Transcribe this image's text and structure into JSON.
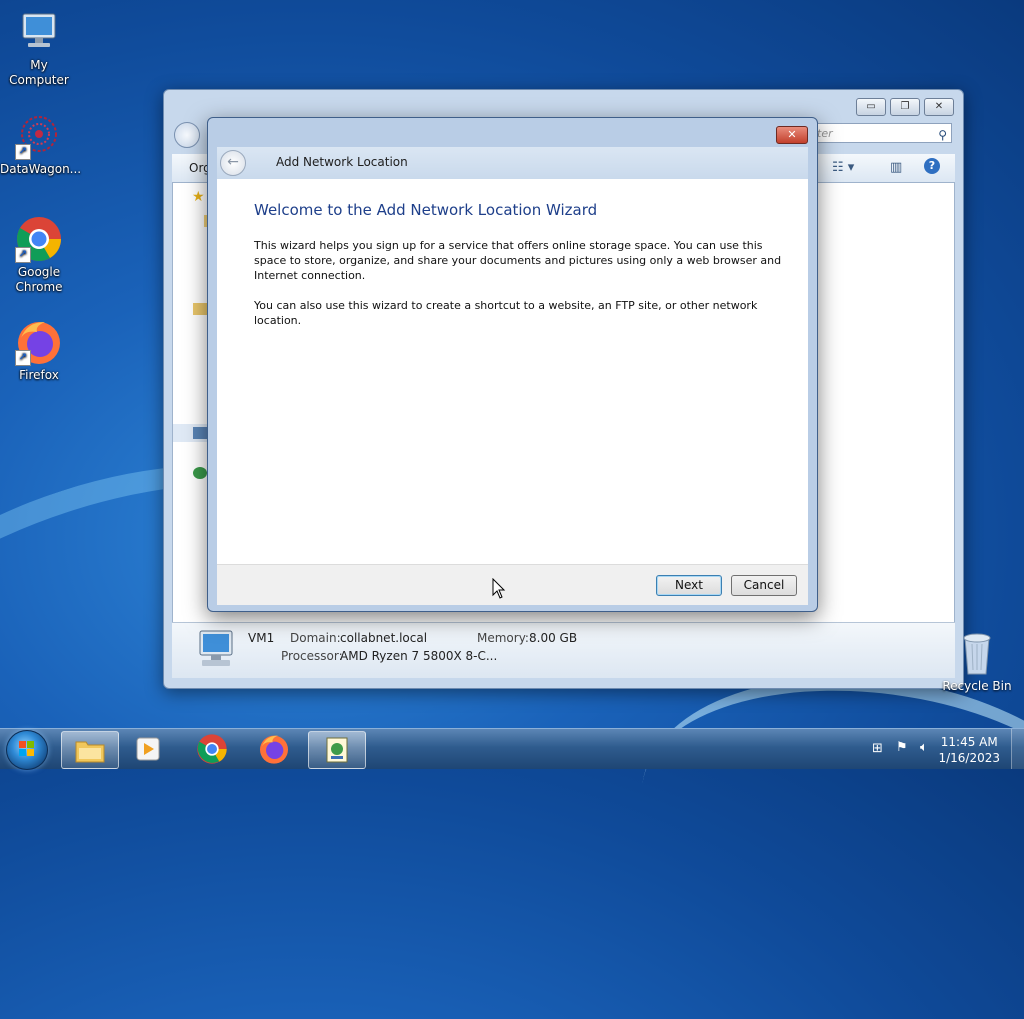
{
  "desktop": {
    "icons": [
      {
        "label": "My Computer"
      },
      {
        "label": "DataWagon..."
      },
      {
        "label": "Google Chrome"
      },
      {
        "label": "Firefox"
      }
    ],
    "recycle_bin": "Recycle Bin"
  },
  "explorer": {
    "search_placeholder": "ter",
    "organize_label": "Org",
    "details": {
      "computer_name": "VM1",
      "domain_label": "Domain:",
      "domain_value": "collabnet.local",
      "memory_label": "Memory:",
      "memory_value": "8.00 GB",
      "processor_label": "Processor:",
      "processor_value": "AMD Ryzen 7 5800X 8-C..."
    }
  },
  "wizard": {
    "title": "Add Network Location",
    "heading": "Welcome to the Add Network Location Wizard",
    "paragraph1": "This wizard helps you sign up for a service that offers online storage space.  You can use this space to store, organize, and share your documents and pictures using only a web browser and Internet connection.",
    "paragraph2": "You can also use this wizard to create a shortcut to a website, an FTP site, or other network location.",
    "next_label": "Next",
    "cancel_label": "Cancel"
  },
  "taskbar": {
    "time": "11:45 AM",
    "date": "1/16/2023"
  },
  "colors": {
    "desktop_bg": "#1a62b9",
    "wizard_heading": "#1e3f8a",
    "taskbar": "#2f5c8e"
  }
}
